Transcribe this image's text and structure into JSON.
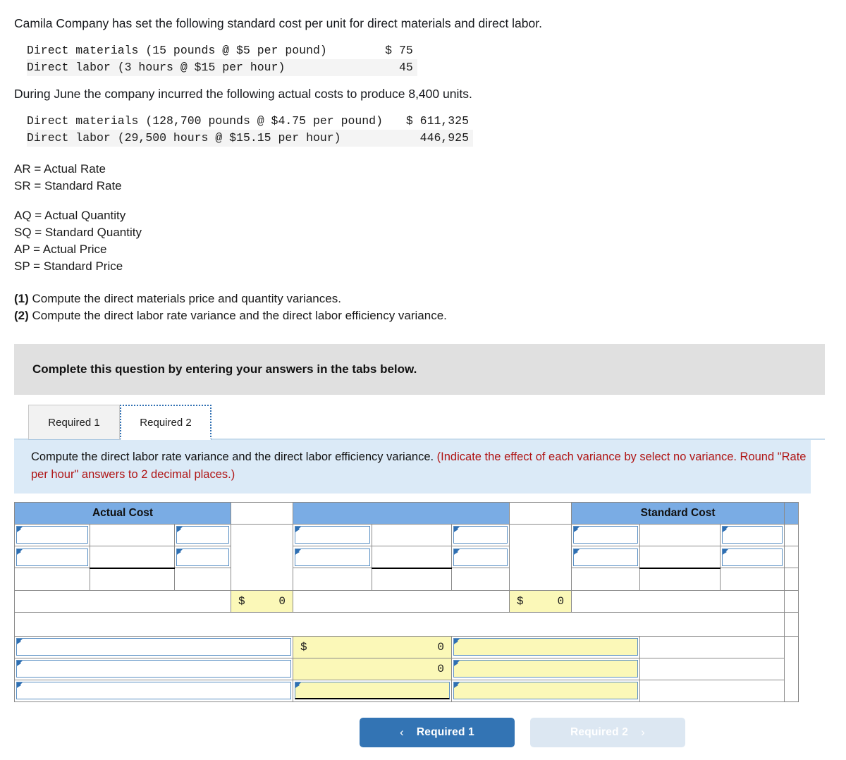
{
  "intro": {
    "line1": "Camila Company has set the following standard cost per unit for direct materials and direct labor.",
    "line2": "During June the company incurred the following actual costs to produce 8,400 units."
  },
  "standard_table": {
    "rows": [
      {
        "label": "Direct materials (15 pounds @ $5 per pound)",
        "amount": "$ 75"
      },
      {
        "label": "Direct labor (3 hours @ $15 per hour)",
        "amount": "45"
      }
    ]
  },
  "actual_table": {
    "rows": [
      {
        "label": "Direct materials (128,700 pounds @ $4.75 per pound)",
        "amount": "$ 611,325"
      },
      {
        "label": "Direct labor (29,500 hours @ $15.15 per hour)",
        "amount": "446,925"
      }
    ]
  },
  "definitions": [
    "AR = Actual Rate",
    "SR = Standard Rate",
    "AQ = Actual Quantity",
    "SQ = Standard Quantity",
    "AP = Actual Price",
    "SP = Standard Price"
  ],
  "requirements": [
    {
      "num": "(1)",
      "text": " Compute the direct materials price and quantity variances."
    },
    {
      "num": "(2)",
      "text": " Compute the direct labor rate variance and the direct labor efficiency variance."
    }
  ],
  "banner": {
    "text": "Complete this question by entering your answers in the tabs below."
  },
  "tabs": [
    {
      "label": "Required 1",
      "active": false
    },
    {
      "label": "Required 2",
      "active": true
    }
  ],
  "instruction": {
    "black": "Compute the direct labor rate variance and the direct labor efficiency variance. ",
    "red": "(Indicate the effect of each variance by select no variance. Round \"Rate per hour\" answers to 2 decimal places.)"
  },
  "answer_table": {
    "headers": {
      "actual_cost": "Actual Cost",
      "middle": "",
      "standard_cost": "Standard Cost"
    },
    "computed": {
      "actual_total_dollar": "$",
      "actual_total_value": "0",
      "standard_total_dollar": "$",
      "standard_total_value": "0",
      "variance1_dollar": "$",
      "variance1_value": "0",
      "variance2_value": "0",
      "variance3_value": ""
    },
    "inputs": {
      "empty_value": ""
    }
  },
  "nav": {
    "prev": {
      "label": "Required 1",
      "chevron": "‹"
    },
    "next": {
      "label": "Required 2",
      "chevron": "›"
    }
  },
  "colors": {
    "header_blue": "#7aace4",
    "input_yellow": "#fbf8b8",
    "instruction_bg": "#dbeaf7",
    "banner_gray": "#e0e0e0",
    "primary_button": "#3374b4",
    "ghost_button": "#dce7f2",
    "red_text": "#b01515"
  }
}
